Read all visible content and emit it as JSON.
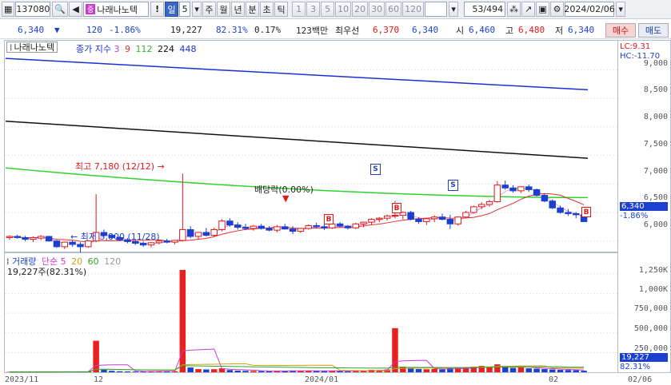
{
  "toolbar": {
    "code": "137080",
    "stock_name": "나래나노텍",
    "period_num": "5",
    "period_tabs": [
      "일",
      "주",
      "월",
      "년",
      "분",
      "초",
      "틱"
    ],
    "tick_options": [
      "1",
      "3",
      "5",
      "10",
      "20",
      "30",
      "60",
      "120"
    ],
    "page": "53/494",
    "date": "2024/02/06"
  },
  "quote": {
    "price": "6,340",
    "change": "120",
    "change_pct": "-1.86%",
    "volume": "19,227",
    "vol_ratio": "82.31%",
    "turnover": "0.17%",
    "amount_label": "123백만",
    "best_ask_label": "최우선",
    "best_ask": "6,370",
    "best_bid": "6,340",
    "open_label": "시",
    "open": "6,460",
    "high_label": "고",
    "high": "6,480",
    "low_label": "저",
    "low": "6,340",
    "buy_label": "매수",
    "sell_label": "매도"
  },
  "price_panel": {
    "name_box": "나래나노텍",
    "legend_title": "종가 지수",
    "legend_periods": [
      "3",
      "9",
      "112",
      "224",
      "448"
    ],
    "lc": "LC:9.31",
    "hc": "HC:-11.70",
    "yticks": [
      "9,000",
      "8,500",
      "8,000",
      "7,500",
      "7,000",
      "6,500",
      "6,000"
    ],
    "current_price": "6,340",
    "current_pct": "-1.86%",
    "high_note": "최고 7,180 (12/12)",
    "low_note": "최저 5,800 (11/28)",
    "dividend_note": "배당락(0.00%)"
  },
  "volume_panel": {
    "legend_title": "거래량",
    "legend_sub": "단순",
    "legend_periods": [
      "5",
      "20",
      "60",
      "120"
    ],
    "volume_note": "19,227주(82.31%)",
    "yticks": [
      "1,250K",
      "1,000K",
      "750,000",
      "500,000",
      "250,000"
    ],
    "current_vol": "19,227",
    "current_pct": "82.31%"
  },
  "x_axis": [
    "2023/11",
    "12",
    "2024/01",
    "02",
    "02/06"
  ],
  "colors": {
    "up": "#e01818",
    "down": "#1a3fd1",
    "ma448": "#1a2fd6",
    "ma224": "#111111",
    "ma112": "#2fd12f",
    "ma9": "#e03030",
    "ma3": "#c83ad0"
  },
  "chart_data": {
    "type": "candlestick",
    "price_ylim": [
      5800,
      9300
    ],
    "ma448_range": [
      9200,
      8650
    ],
    "ma224_range": [
      8100,
      7450
    ],
    "ma112_range": [
      7280,
      6760
    ],
    "candles": [
      [
        6060,
        6100,
        6020,
        6080
      ],
      [
        6080,
        6110,
        6040,
        6060
      ],
      [
        6060,
        6090,
        6000,
        6030
      ],
      [
        6030,
        6080,
        5980,
        6060
      ],
      [
        6050,
        6100,
        6020,
        6080
      ],
      [
        6080,
        6090,
        5990,
        6000
      ],
      [
        6000,
        6020,
        5880,
        5900
      ],
      [
        5900,
        5990,
        5860,
        5980
      ],
      [
        5980,
        6010,
        5900,
        5940
      ],
      [
        5940,
        5980,
        5800,
        5900
      ],
      [
        5900,
        6010,
        5880,
        6000
      ],
      [
        6000,
        6820,
        5980,
        6150
      ],
      [
        6150,
        6200,
        6070,
        6100
      ],
      [
        6100,
        6120,
        6030,
        6060
      ],
      [
        6060,
        6080,
        6000,
        6020
      ],
      [
        6020,
        6050,
        5960,
        5990
      ],
      [
        5990,
        6020,
        5930,
        5960
      ],
      [
        5960,
        5990,
        5900,
        5930
      ],
      [
        5930,
        5980,
        5890,
        5970
      ],
      [
        5970,
        6020,
        5940,
        6000
      ],
      [
        6000,
        6040,
        5960,
        5980
      ],
      [
        5980,
        6020,
        5940,
        6010
      ],
      [
        6010,
        7180,
        5990,
        6200
      ],
      [
        6200,
        6260,
        6050,
        6080
      ],
      [
        6080,
        6160,
        6040,
        6150
      ],
      [
        6150,
        6230,
        6080,
        6100
      ],
      [
        6100,
        6230,
        6070,
        6200
      ],
      [
        6200,
        6380,
        6170,
        6350
      ],
      [
        6350,
        6400,
        6250,
        6280
      ],
      [
        6280,
        6330,
        6200,
        6240
      ],
      [
        6240,
        6300,
        6190,
        6220
      ],
      [
        6220,
        6280,
        6180,
        6260
      ],
      [
        6260,
        6300,
        6200,
        6220
      ],
      [
        6220,
        6260,
        6170,
        6190
      ],
      [
        6190,
        6280,
        6150,
        6250
      ],
      [
        6250,
        6300,
        6200,
        6210
      ],
      [
        6210,
        6260,
        6120,
        6170
      ],
      [
        6170,
        6230,
        6140,
        6220
      ],
      [
        6220,
        6290,
        6200,
        6270
      ],
      [
        6270,
        6320,
        6230,
        6250
      ],
      [
        6250,
        6290,
        6190,
        6230
      ],
      [
        6230,
        6310,
        6210,
        6300
      ],
      [
        6300,
        6330,
        6240,
        6260
      ],
      [
        6260,
        6280,
        6200,
        6230
      ],
      [
        6230,
        6320,
        6210,
        6300
      ],
      [
        6300,
        6340,
        6240,
        6330
      ],
      [
        6330,
        6400,
        6290,
        6380
      ],
      [
        6380,
        6420,
        6330,
        6400
      ],
      [
        6400,
        6460,
        6360,
        6440
      ],
      [
        6440,
        6700,
        6400,
        6450
      ],
      [
        6450,
        6520,
        6380,
        6500
      ],
      [
        6500,
        6530,
        6360,
        6380
      ],
      [
        6380,
        6420,
        6300,
        6340
      ],
      [
        6340,
        6400,
        6280,
        6390
      ],
      [
        6390,
        6450,
        6330,
        6420
      ],
      [
        6420,
        6480,
        6360,
        6380
      ],
      [
        6380,
        6460,
        6210,
        6300
      ],
      [
        6300,
        6430,
        6270,
        6420
      ],
      [
        6420,
        6530,
        6400,
        6500
      ],
      [
        6500,
        6620,
        6480,
        6600
      ],
      [
        6600,
        6680,
        6560,
        6640
      ],
      [
        6640,
        6720,
        6600,
        6690
      ],
      [
        6690,
        7050,
        6670,
        6980
      ],
      [
        6980,
        7060,
        6900,
        6930
      ],
      [
        6930,
        6980,
        6850,
        6880
      ],
      [
        6880,
        6960,
        6840,
        6950
      ],
      [
        6950,
        6990,
        6860,
        6900
      ],
      [
        6900,
        6920,
        6780,
        6800
      ],
      [
        6800,
        6830,
        6680,
        6700
      ],
      [
        6700,
        6730,
        6560,
        6580
      ],
      [
        6580,
        6620,
        6480,
        6500
      ],
      [
        6500,
        6560,
        6440,
        6480
      ],
      [
        6480,
        6510,
        6400,
        6460
      ],
      [
        6460,
        6480,
        6340,
        6340
      ]
    ],
    "volumes": [
      4,
      3,
      3,
      5,
      4,
      3,
      8,
      6,
      5,
      9,
      10,
      400,
      30,
      18,
      12,
      10,
      8,
      9,
      12,
      15,
      11,
      14,
      1300,
      60,
      40,
      35,
      38,
      50,
      28,
      20,
      18,
      16,
      14,
      12,
      18,
      16,
      22,
      20,
      18,
      15,
      14,
      20,
      16,
      12,
      18,
      22,
      30,
      28,
      35,
      560,
      70,
      45,
      40,
      38,
      42,
      35,
      50,
      55,
      60,
      70,
      80,
      65,
      100,
      70,
      55,
      60,
      50,
      45,
      40,
      35,
      30,
      28,
      25,
      19
    ]
  }
}
